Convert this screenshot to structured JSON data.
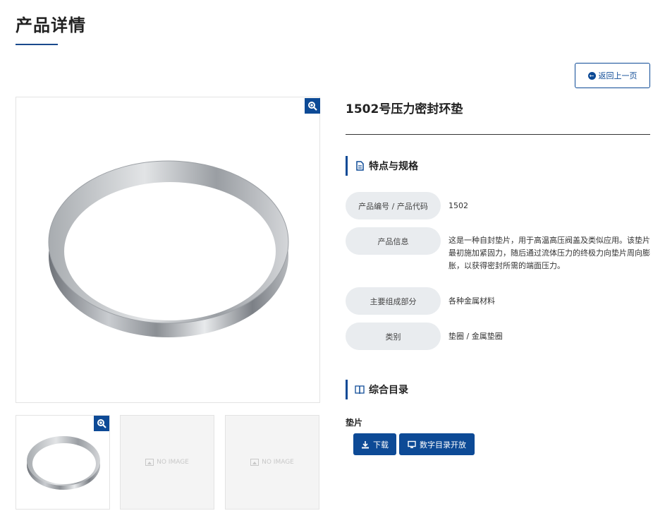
{
  "page": {
    "title": "产品详情"
  },
  "back_button": {
    "label": "返回上一页"
  },
  "product": {
    "name": "1502号压力密封环垫"
  },
  "specs_section": {
    "title": "特点与规格"
  },
  "specs": [
    {
      "label": "产品编号 / 产品代码",
      "value": "1502"
    },
    {
      "label": "产品信息",
      "value": "这是一种自封垫片，用于高温高压阀盖及类似应用。该垫片最初施加紧固力，随后通过流体压力的终极力向垫片周向膨胀，以获得密封所需的端面压力。"
    },
    {
      "label": "主要组成部分",
      "value": "各种金属材料"
    },
    {
      "label": "类别",
      "value": "垫圈 / 金属垫圈"
    }
  ],
  "catalog_section": {
    "title": "综合目录"
  },
  "catalog": {
    "item_label": "垫片",
    "download_label": "下载",
    "digital_label": "数字目录开放"
  },
  "thumbnails": {
    "placeholder_text": "NO IMAGE"
  },
  "colors": {
    "accent": "#0d4a96",
    "label_bg": "#e9ecef"
  }
}
